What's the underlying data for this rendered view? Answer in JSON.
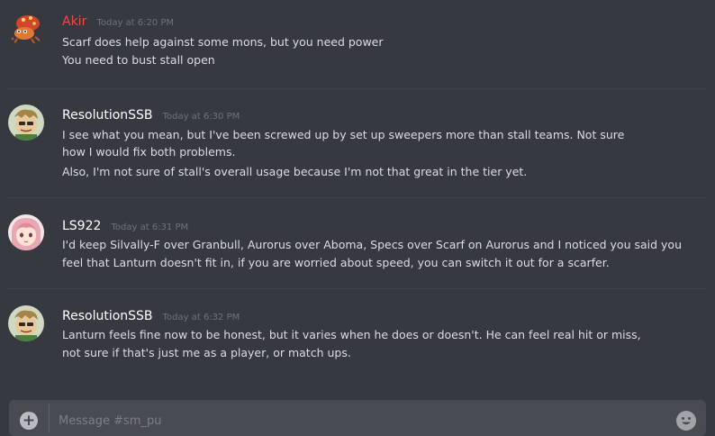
{
  "messages": [
    {
      "username": "Akir",
      "timestamp": "Today at 6:20 PM",
      "lines": [
        "Scarf does help against some mons, but you need power",
        "You need to bust stall open"
      ]
    },
    {
      "username": "ResolutionSSB",
      "timestamp": "Today at 6:30 PM",
      "lines": [
        "I see what you mean, but I've been screwed up by set up sweepers more than stall teams. Not sure how I would fix both problems.",
        "Also, I'm not sure of stall's overall usage because I'm not that great in the tier yet."
      ]
    },
    {
      "username": "LS922",
      "timestamp": "Today at 6:31 PM",
      "lines": [
        "I'd keep Silvally-F over Granbull, Aurorus over Aboma, Specs over Scarf on Aurorus and I noticed you said you feel that Lanturn doesn't fit in, if you are worried about speed, you can switch it out for a scarfer."
      ]
    },
    {
      "username": "ResolutionSSB",
      "timestamp": "Today at 6:32 PM",
      "lines": [
        "Lanturn feels fine now to be honest, but it varies when he does or doesn't. He can feel real hit or miss, not sure if that's just me as a player, or match ups."
      ]
    }
  ],
  "composer": {
    "placeholder": "Message #sm_pu",
    "add_icon": "plus-circle-icon",
    "emoji_icon": "emoji-icon"
  },
  "colors": {
    "background": "#36393f",
    "username_highlight": "#f04747",
    "timestamp": "#6f7278",
    "composer": "#484b51"
  }
}
